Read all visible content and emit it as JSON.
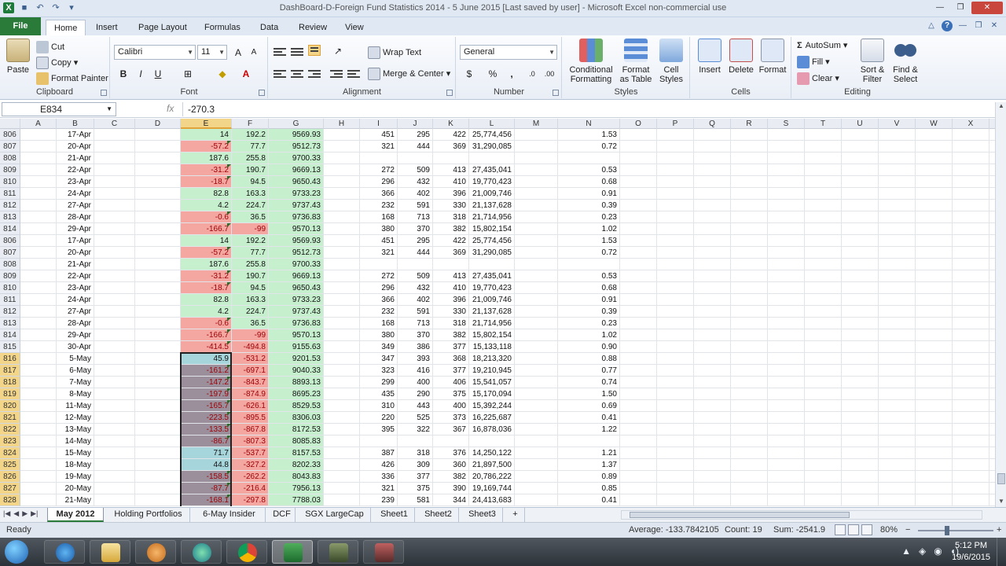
{
  "window": {
    "title": "DashBoard-D-Foreign Fund Statistics 2014 - 5 June 2015 [Last saved by user] - Microsoft Excel non-commercial use"
  },
  "tabs": [
    "File",
    "Home",
    "Insert",
    "Page Layout",
    "Formulas",
    "Data",
    "Review",
    "View"
  ],
  "ribbon": {
    "clipboard": {
      "label": "Clipboard",
      "paste": "Paste",
      "cut": "Cut",
      "copy": "Copy",
      "format_painter": "Format Painter"
    },
    "font": {
      "label": "Font",
      "name": "Calibri",
      "size": "11",
      "bold": "B",
      "italic": "I",
      "underline": "U"
    },
    "alignment": {
      "label": "Alignment",
      "wrap_text": "Wrap Text",
      "merge_center": "Merge & Center"
    },
    "number": {
      "label": "Number",
      "format": "General",
      "currency": "$",
      "percent": "%",
      "comma": ",",
      "inc_dec": ".0",
      "dec_dec": ".00"
    },
    "styles": {
      "label": "Styles",
      "conditional": "Conditional Formatting",
      "format_table": "Format as Table",
      "cell_styles": "Cell Styles"
    },
    "cells": {
      "label": "Cells",
      "insert": "Insert",
      "delete": "Delete",
      "format": "Format"
    },
    "editing": {
      "label": "Editing",
      "autosum": "AutoSum",
      "fill": "Fill",
      "clear": "Clear",
      "sort_filter": "Sort & Filter",
      "find_select": "Find & Select"
    }
  },
  "formula_bar": {
    "name_box": "E834",
    "fx": "fx",
    "value": "-270.3"
  },
  "columns": [
    "A",
    "B",
    "C",
    "D",
    "E",
    "F",
    "G",
    "H",
    "I",
    "J",
    "K",
    "L",
    "M",
    "N",
    "O",
    "P",
    "Q",
    "R",
    "S",
    "T",
    "U",
    "V",
    "W",
    "X"
  ],
  "rows": [
    {
      "n": "806",
      "b": "17-Apr",
      "e": "14",
      "ec": "g",
      "f": "192.2",
      "fc": "g",
      "g": "9569.93",
      "i": "451",
      "j": "295",
      "k": "422",
      "l": "25,774,456",
      "nn": "1.53"
    },
    {
      "n": "807",
      "b": "20-Apr",
      "e": "-57.2",
      "ec": "r",
      "f": "77.7",
      "fc": "g",
      "g": "9512.73",
      "i": "321",
      "j": "444",
      "k": "369",
      "l": "31,290,085",
      "nn": "0.72"
    },
    {
      "n": "808",
      "b": "21-Apr",
      "e": "187.6",
      "ec": "g",
      "f": "255.8",
      "fc": "g",
      "g": "9700.33",
      "i": "",
      "j": "",
      "k": "",
      "l": "",
      "nn": ""
    },
    {
      "n": "809",
      "b": "22-Apr",
      "e": "-31.2",
      "ec": "r",
      "f": "190.7",
      "fc": "g",
      "g": "9669.13",
      "i": "272",
      "j": "509",
      "k": "413",
      "l": "27,435,041",
      "nn": "0.53"
    },
    {
      "n": "810",
      "b": "23-Apr",
      "e": "-18.7",
      "ec": "r",
      "f": "94.5",
      "fc": "g",
      "g": "9650.43",
      "i": "296",
      "j": "432",
      "k": "410",
      "l": "19,770,423",
      "nn": "0.68"
    },
    {
      "n": "811",
      "b": "24-Apr",
      "e": "82.8",
      "ec": "g",
      "f": "163.3",
      "fc": "g",
      "g": "9733.23",
      "i": "366",
      "j": "402",
      "k": "396",
      "l": "21,009,746",
      "nn": "0.91"
    },
    {
      "n": "812",
      "b": "27-Apr",
      "e": "4.2",
      "ec": "g",
      "f": "224.7",
      "fc": "g",
      "g": "9737.43",
      "i": "232",
      "j": "591",
      "k": "330",
      "l": "21,137,628",
      "nn": "0.39"
    },
    {
      "n": "813",
      "b": "28-Apr",
      "e": "-0.6",
      "ec": "r",
      "f": "36.5",
      "fc": "g",
      "g": "9736.83",
      "i": "168",
      "j": "713",
      "k": "318",
      "l": "21,714,956",
      "nn": "0.23"
    },
    {
      "n": "814",
      "b": "29-Apr",
      "e": "-166.7",
      "ec": "r",
      "f": "-99",
      "fc": "r",
      "g": "9570.13",
      "i": "380",
      "j": "370",
      "k": "382",
      "l": "15,802,154",
      "nn": "1.02"
    },
    {
      "n": "806",
      "b": "17-Apr",
      "e": "14",
      "ec": "g",
      "f": "192.2",
      "fc": "g",
      "g": "9569.93",
      "i": "451",
      "j": "295",
      "k": "422",
      "l": "25,774,456",
      "nn": "1.53"
    },
    {
      "n": "807",
      "b": "20-Apr",
      "e": "-57.2",
      "ec": "r",
      "f": "77.7",
      "fc": "g",
      "g": "9512.73",
      "i": "321",
      "j": "444",
      "k": "369",
      "l": "31,290,085",
      "nn": "0.72"
    },
    {
      "n": "808",
      "b": "21-Apr",
      "e": "187.6",
      "ec": "g",
      "f": "255.8",
      "fc": "g",
      "g": "9700.33",
      "i": "",
      "j": "",
      "k": "",
      "l": "",
      "nn": ""
    },
    {
      "n": "809",
      "b": "22-Apr",
      "e": "-31.2",
      "ec": "r",
      "f": "190.7",
      "fc": "g",
      "g": "9669.13",
      "i": "272",
      "j": "509",
      "k": "413",
      "l": "27,435,041",
      "nn": "0.53"
    },
    {
      "n": "810",
      "b": "23-Apr",
      "e": "-18.7",
      "ec": "r",
      "f": "94.5",
      "fc": "g",
      "g": "9650.43",
      "i": "296",
      "j": "432",
      "k": "410",
      "l": "19,770,423",
      "nn": "0.68"
    },
    {
      "n": "811",
      "b": "24-Apr",
      "e": "82.8",
      "ec": "g",
      "f": "163.3",
      "fc": "g",
      "g": "9733.23",
      "i": "366",
      "j": "402",
      "k": "396",
      "l": "21,009,746",
      "nn": "0.91"
    },
    {
      "n": "812",
      "b": "27-Apr",
      "e": "4.2",
      "ec": "g",
      "f": "224.7",
      "fc": "g",
      "g": "9737.43",
      "i": "232",
      "j": "591",
      "k": "330",
      "l": "21,137,628",
      "nn": "0.39"
    },
    {
      "n": "813",
      "b": "28-Apr",
      "e": "-0.6",
      "ec": "r",
      "f": "36.5",
      "fc": "g",
      "g": "9736.83",
      "i": "168",
      "j": "713",
      "k": "318",
      "l": "21,714,956",
      "nn": "0.23"
    },
    {
      "n": "814",
      "b": "29-Apr",
      "e": "-166.7",
      "ec": "r",
      "f": "-99",
      "fc": "r",
      "g": "9570.13",
      "i": "380",
      "j": "370",
      "k": "382",
      "l": "15,802,154",
      "nn": "1.02"
    },
    {
      "n": "815",
      "b": "30-Apr",
      "e": "-414.5",
      "ec": "r",
      "f": "-494.8",
      "fc": "r",
      "g": "9155.63",
      "i": "349",
      "j": "386",
      "k": "377",
      "l": "15,133,118",
      "nn": "0.90"
    },
    {
      "n": "816",
      "b": "5-May",
      "e": "45.9",
      "ec": "t",
      "f": "-531.2",
      "fc": "r",
      "g": "9201.53",
      "i": "347",
      "j": "393",
      "k": "368",
      "l": "18,213,320",
      "nn": "0.88"
    },
    {
      "n": "817",
      "b": "6-May",
      "e": "-161.2",
      "ec": "p",
      "f": "-697.1",
      "fc": "r",
      "g": "9040.33",
      "i": "323",
      "j": "416",
      "k": "377",
      "l": "19,210,945",
      "nn": "0.77"
    },
    {
      "n": "818",
      "b": "7-May",
      "e": "-147.2",
      "ec": "p",
      "f": "-843.7",
      "fc": "r",
      "g": "8893.13",
      "i": "299",
      "j": "400",
      "k": "406",
      "l": "15,541,057",
      "nn": "0.74"
    },
    {
      "n": "819",
      "b": "8-May",
      "e": "-197.9",
      "ec": "p",
      "f": "-874.9",
      "fc": "r",
      "g": "8695.23",
      "i": "435",
      "j": "290",
      "k": "375",
      "l": "15,170,094",
      "nn": "1.50"
    },
    {
      "n": "820",
      "b": "11-May",
      "e": "-165.7",
      "ec": "p",
      "f": "-626.1",
      "fc": "r",
      "g": "8529.53",
      "i": "310",
      "j": "443",
      "k": "400",
      "l": "15,392,244",
      "nn": "0.69"
    },
    {
      "n": "821",
      "b": "12-May",
      "e": "-223.5",
      "ec": "p",
      "f": "-895.5",
      "fc": "r",
      "g": "8306.03",
      "i": "220",
      "j": "525",
      "k": "373",
      "l": "16,225,687",
      "nn": "0.41"
    },
    {
      "n": "822",
      "b": "13-May",
      "e": "-133.5",
      "ec": "p",
      "f": "-867.8",
      "fc": "r",
      "g": "8172.53",
      "i": "395",
      "j": "322",
      "k": "367",
      "l": "16,878,036",
      "nn": "1.22"
    },
    {
      "n": "823",
      "b": "14-May",
      "e": "-86.7",
      "ec": "p",
      "f": "-807.3",
      "fc": "r",
      "g": "8085.83",
      "i": "",
      "j": "",
      "k": "",
      "l": "",
      "nn": ""
    },
    {
      "n": "824",
      "b": "15-May",
      "e": "71.7",
      "ec": "t",
      "f": "-537.7",
      "fc": "r",
      "g": "8157.53",
      "i": "387",
      "j": "318",
      "k": "376",
      "l": "14,250,122",
      "nn": "1.21"
    },
    {
      "n": "825",
      "b": "18-May",
      "e": "44.8",
      "ec": "t",
      "f": "-327.2",
      "fc": "r",
      "g": "8202.33",
      "i": "426",
      "j": "309",
      "k": "360",
      "l": "21,897,500",
      "nn": "1.37"
    },
    {
      "n": "826",
      "b": "19-May",
      "e": "-158.5",
      "ec": "p",
      "f": "-262.2",
      "fc": "r",
      "g": "8043.83",
      "i": "336",
      "j": "377",
      "k": "382",
      "l": "20,786,222",
      "nn": "0.89"
    },
    {
      "n": "827",
      "b": "20-May",
      "e": "-87.7",
      "ec": "p",
      "f": "-216.4",
      "fc": "r",
      "g": "7956.13",
      "i": "321",
      "j": "375",
      "k": "390",
      "l": "19,169,744",
      "nn": "0.85"
    },
    {
      "n": "828",
      "b": "21-May",
      "e": "-168.1",
      "ec": "p",
      "f": "-297.8",
      "fc": "r",
      "g": "7788.03",
      "i": "239",
      "j": "581",
      "k": "344",
      "l": "24,413,683",
      "nn": "0.41"
    }
  ],
  "sheets": [
    "May 2012",
    "Holding Portfolios",
    "6-May Insider",
    "DCF",
    "SGX LargeCap",
    "Sheet1",
    "Sheet2",
    "Sheet3"
  ],
  "status": {
    "ready": "Ready",
    "average": "Average: -133.7842105",
    "count": "Count: 19",
    "sum": "Sum: -2541.9",
    "zoom": "80%"
  },
  "taskbar": {
    "time": "5:12 PM",
    "date": "19/6/2015"
  },
  "colors": {
    "green_fill": "#c6efce",
    "red_fill": "#f4a6a0",
    "selected_fill": "#9b8f9c",
    "teal_fill": "#a6d6db",
    "accent": "#2a7a3a"
  }
}
